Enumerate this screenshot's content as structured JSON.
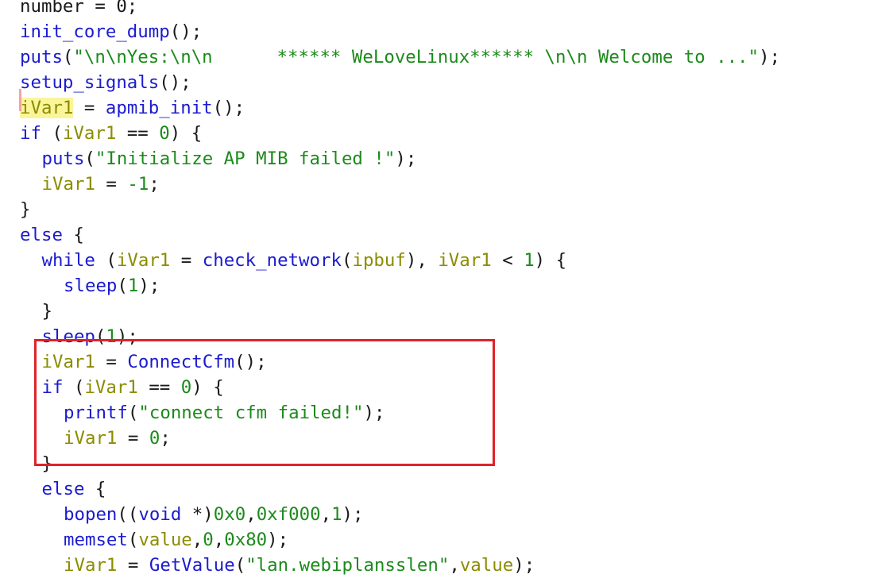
{
  "colors": {
    "background": "#ffffff",
    "plain": "#1a1a1a",
    "keyword": "#1b1bd0",
    "function": "#1b1bd0",
    "variable": "#8c8c00",
    "number_string": "#1c8a1c",
    "variable_highlight_bg": "#fbf59a",
    "annotation_box": "#e0222a"
  },
  "code_lines": [
    {
      "indent": 0,
      "tokens": [
        [
          "plain",
          "number = 0;"
        ]
      ]
    },
    {
      "indent": 0,
      "tokens": [
        [
          "fn",
          "init_core_dump"
        ],
        [
          "plain",
          "();"
        ]
      ]
    },
    {
      "indent": 0,
      "tokens": [
        [
          "fn",
          "puts"
        ],
        [
          "plain",
          "("
        ],
        [
          "str",
          "\"\\n\\nYes:\\n\\n      ****** WeLoveLinux****** \\n\\n Welcome to ...\""
        ],
        [
          "plain",
          ");"
        ]
      ]
    },
    {
      "indent": 0,
      "tokens": [
        [
          "fn",
          "setup_signals"
        ],
        [
          "plain",
          "();"
        ]
      ]
    },
    {
      "indent": 0,
      "tokens": [
        [
          "hl",
          "iVar1"
        ],
        [
          "plain",
          " = "
        ],
        [
          "fn",
          "apmib_init"
        ],
        [
          "plain",
          "();"
        ]
      ]
    },
    {
      "indent": 0,
      "tokens": [
        [
          "kw",
          "if"
        ],
        [
          "plain",
          " ("
        ],
        [
          "var",
          "iVar1"
        ],
        [
          "plain",
          " == "
        ],
        [
          "num",
          "0"
        ],
        [
          "plain",
          ") {"
        ]
      ]
    },
    {
      "indent": 1,
      "tokens": [
        [
          "fn",
          "puts"
        ],
        [
          "plain",
          "("
        ],
        [
          "str",
          "\"Initialize AP MIB failed !\""
        ],
        [
          "plain",
          ");"
        ]
      ]
    },
    {
      "indent": 1,
      "tokens": [
        [
          "var",
          "iVar1"
        ],
        [
          "plain",
          " = "
        ],
        [
          "num",
          "-1"
        ],
        [
          "plain",
          ";"
        ]
      ]
    },
    {
      "indent": 0,
      "tokens": [
        [
          "plain",
          "}"
        ]
      ]
    },
    {
      "indent": 0,
      "tokens": [
        [
          "kw",
          "else"
        ],
        [
          "plain",
          " {"
        ]
      ]
    },
    {
      "indent": 1,
      "tokens": [
        [
          "kw",
          "while"
        ],
        [
          "plain",
          " ("
        ],
        [
          "var",
          "iVar1"
        ],
        [
          "plain",
          " = "
        ],
        [
          "fn",
          "check_network"
        ],
        [
          "plain",
          "("
        ],
        [
          "var",
          "ipbuf"
        ],
        [
          "plain",
          "), "
        ],
        [
          "var",
          "iVar1"
        ],
        [
          "plain",
          " < "
        ],
        [
          "num",
          "1"
        ],
        [
          "plain",
          ") {"
        ]
      ]
    },
    {
      "indent": 2,
      "tokens": [
        [
          "fn",
          "sleep"
        ],
        [
          "plain",
          "("
        ],
        [
          "num",
          "1"
        ],
        [
          "plain",
          ");"
        ]
      ]
    },
    {
      "indent": 1,
      "tokens": [
        [
          "plain",
          "}"
        ]
      ]
    },
    {
      "indent": 1,
      "tokens": [
        [
          "fn",
          "sleep"
        ],
        [
          "plain",
          "("
        ],
        [
          "num",
          "1"
        ],
        [
          "plain",
          ");"
        ]
      ]
    },
    {
      "indent": 1,
      "tokens": [
        [
          "var",
          "iVar1"
        ],
        [
          "plain",
          " = "
        ],
        [
          "fn",
          "ConnectCfm"
        ],
        [
          "plain",
          "();"
        ]
      ]
    },
    {
      "indent": 1,
      "tokens": [
        [
          "kw",
          "if"
        ],
        [
          "plain",
          " ("
        ],
        [
          "var",
          "iVar1"
        ],
        [
          "plain",
          " == "
        ],
        [
          "num",
          "0"
        ],
        [
          "plain",
          ") {"
        ]
      ]
    },
    {
      "indent": 2,
      "tokens": [
        [
          "fn",
          "printf"
        ],
        [
          "plain",
          "("
        ],
        [
          "str",
          "\"connect cfm failed!\""
        ],
        [
          "plain",
          ");"
        ]
      ]
    },
    {
      "indent": 2,
      "tokens": [
        [
          "var",
          "iVar1"
        ],
        [
          "plain",
          " = "
        ],
        [
          "num",
          "0"
        ],
        [
          "plain",
          ";"
        ]
      ]
    },
    {
      "indent": 1,
      "tokens": [
        [
          "plain",
          "}"
        ]
      ]
    },
    {
      "indent": 1,
      "tokens": [
        [
          "kw",
          "else"
        ],
        [
          "plain",
          " {"
        ]
      ]
    },
    {
      "indent": 2,
      "tokens": [
        [
          "fn",
          "bopen"
        ],
        [
          "plain",
          "(("
        ],
        [
          "kw",
          "void"
        ],
        [
          "plain",
          " *)"
        ],
        [
          "num",
          "0x0"
        ],
        [
          "plain",
          ","
        ],
        [
          "num",
          "0xf000"
        ],
        [
          "plain",
          ","
        ],
        [
          "num",
          "1"
        ],
        [
          "plain",
          ");"
        ]
      ]
    },
    {
      "indent": 2,
      "tokens": [
        [
          "fn",
          "memset"
        ],
        [
          "plain",
          "("
        ],
        [
          "var",
          "value"
        ],
        [
          "plain",
          ","
        ],
        [
          "num",
          "0"
        ],
        [
          "plain",
          ","
        ],
        [
          "num",
          "0x80"
        ],
        [
          "plain",
          ");"
        ]
      ]
    },
    {
      "indent": 2,
      "tokens": [
        [
          "var",
          "iVar1"
        ],
        [
          "plain",
          " = "
        ],
        [
          "fn",
          "GetValue"
        ],
        [
          "plain",
          "("
        ],
        [
          "str",
          "\"lan.webiplansslen\""
        ],
        [
          "plain",
          ","
        ],
        [
          "var",
          "value"
        ],
        [
          "plain",
          ");"
        ]
      ]
    }
  ]
}
